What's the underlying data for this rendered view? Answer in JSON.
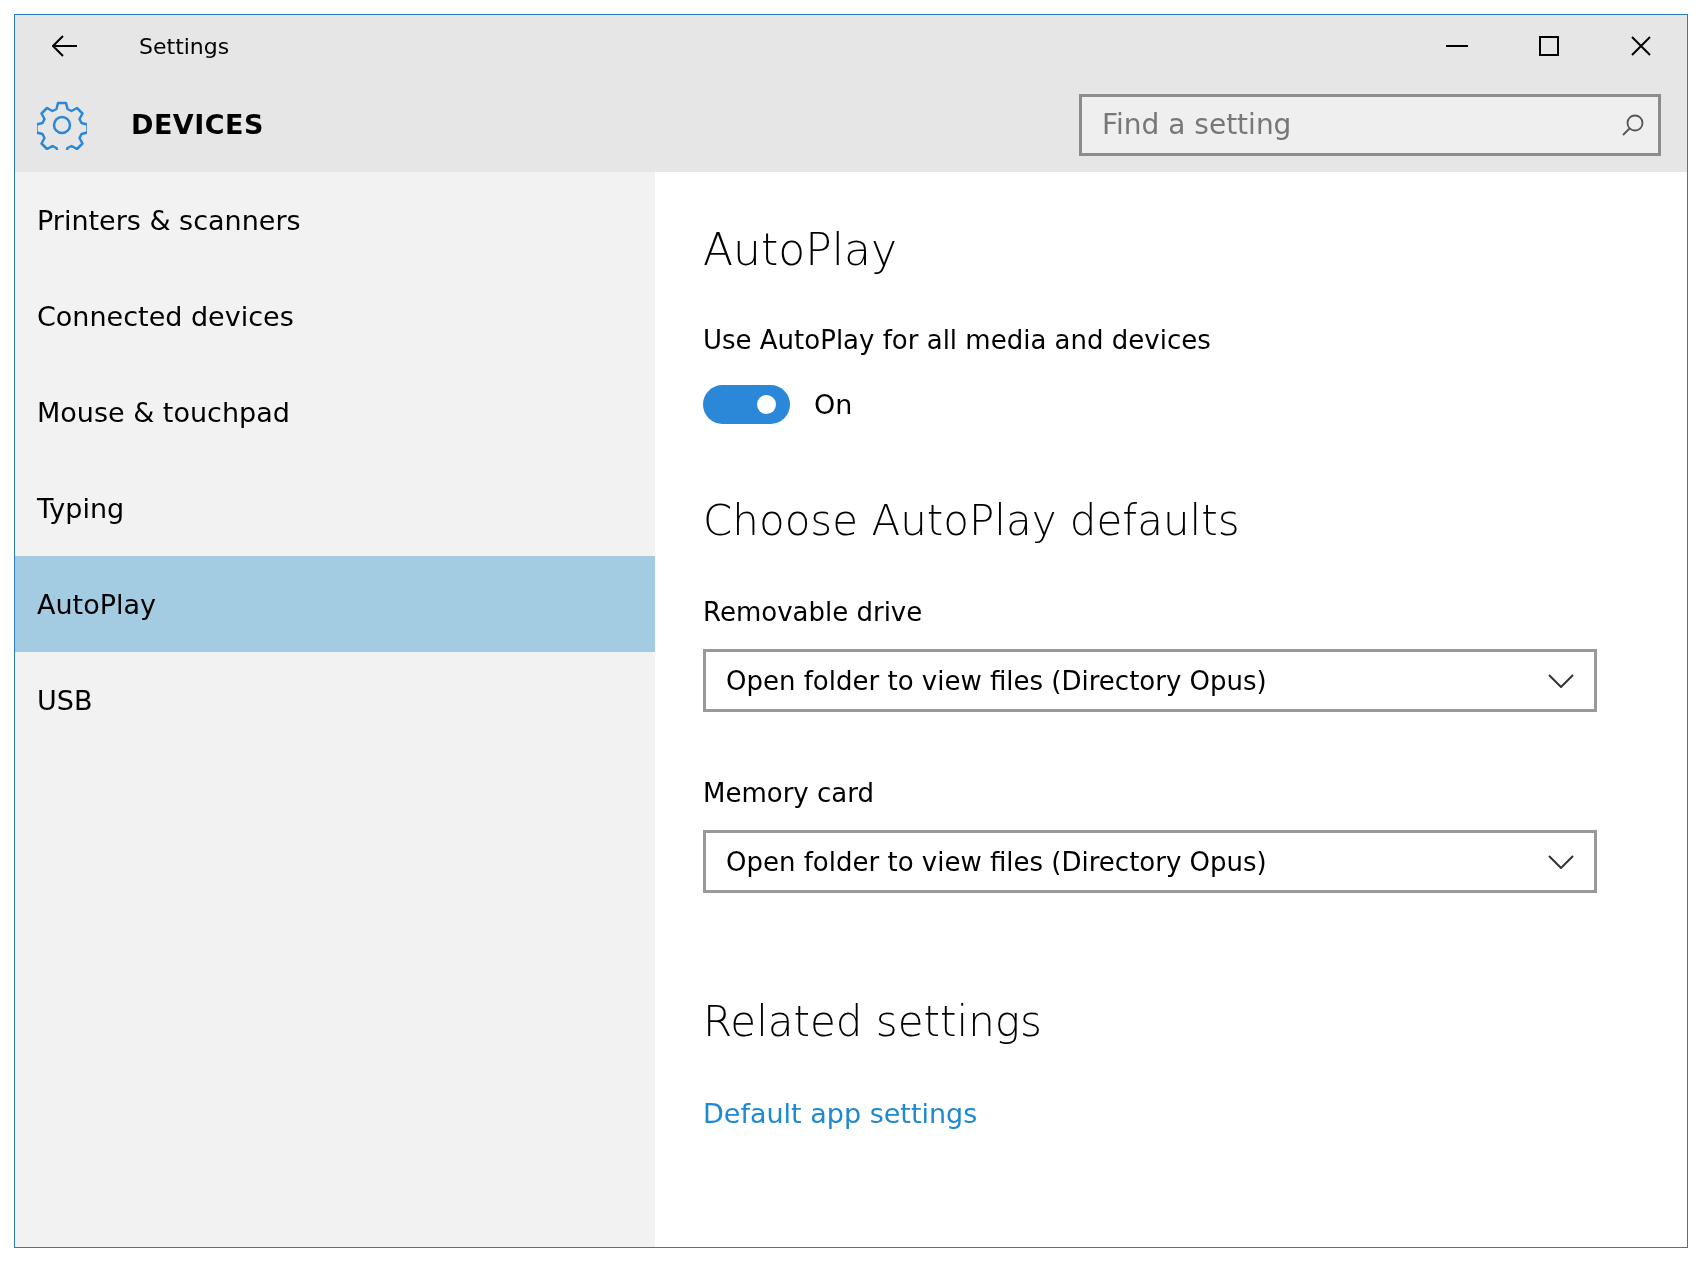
{
  "window": {
    "title": "Settings"
  },
  "header": {
    "title": "DEVICES"
  },
  "search": {
    "placeholder": "Find a setting"
  },
  "sidebar": {
    "items": [
      {
        "label": "Printers & scanners",
        "selected": false
      },
      {
        "label": "Connected devices",
        "selected": false
      },
      {
        "label": "Mouse & touchpad",
        "selected": false
      },
      {
        "label": "Typing",
        "selected": false
      },
      {
        "label": "AutoPlay",
        "selected": true
      },
      {
        "label": "USB",
        "selected": false
      }
    ]
  },
  "content": {
    "title": "AutoPlay",
    "toggle": {
      "label": "Use AutoPlay for all media and devices",
      "on": true,
      "state_text": "On"
    },
    "section_title": "Choose AutoPlay defaults",
    "dropdowns": [
      {
        "label": "Removable drive",
        "value": "Open folder to view files (Directory Opus)"
      },
      {
        "label": "Memory card",
        "value": "Open folder to view files (Directory Opus)"
      }
    ],
    "related": {
      "title": "Related settings",
      "links": [
        "Default app settings"
      ]
    }
  }
}
